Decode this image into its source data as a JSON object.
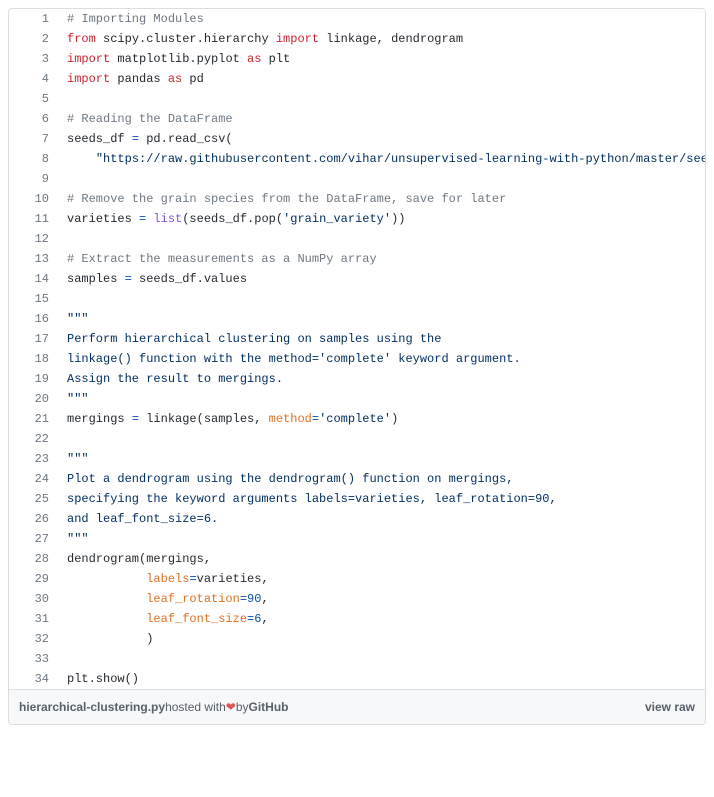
{
  "lines": [
    {
      "n": 1,
      "segs": [
        {
          "c": "pl-c",
          "t": "# Importing Modules"
        }
      ]
    },
    {
      "n": 2,
      "segs": [
        {
          "c": "pl-k",
          "t": "from"
        },
        {
          "t": " scipy.cluster.hierarchy "
        },
        {
          "c": "pl-k",
          "t": "import"
        },
        {
          "t": " linkage, dendrogram"
        }
      ]
    },
    {
      "n": 3,
      "segs": [
        {
          "c": "pl-k",
          "t": "import"
        },
        {
          "t": " matplotlib.pyplot "
        },
        {
          "c": "pl-k",
          "t": "as"
        },
        {
          "t": " plt"
        }
      ]
    },
    {
      "n": 4,
      "segs": [
        {
          "c": "pl-k",
          "t": "import"
        },
        {
          "t": " pandas "
        },
        {
          "c": "pl-k",
          "t": "as"
        },
        {
          "t": " pd"
        }
      ]
    },
    {
      "n": 5,
      "segs": []
    },
    {
      "n": 6,
      "segs": [
        {
          "c": "pl-c",
          "t": "# Reading the DataFrame"
        }
      ]
    },
    {
      "n": 7,
      "segs": [
        {
          "t": "seeds_df "
        },
        {
          "c": "pl-op",
          "t": "="
        },
        {
          "t": " pd.read_csv("
        }
      ]
    },
    {
      "n": 8,
      "segs": [
        {
          "t": "    "
        },
        {
          "c": "pl-s",
          "t": "\"https://raw.githubusercontent.com/vihar/unsupervised-learning-with-python/master/seeds"
        }
      ]
    },
    {
      "n": 9,
      "segs": []
    },
    {
      "n": 10,
      "segs": [
        {
          "c": "pl-c",
          "t": "# Remove the grain species from the DataFrame, save for later"
        }
      ]
    },
    {
      "n": 11,
      "segs": [
        {
          "t": "varieties "
        },
        {
          "c": "pl-op",
          "t": "="
        },
        {
          "t": " "
        },
        {
          "c": "pl-en",
          "t": "list"
        },
        {
          "t": "(seeds_df.pop("
        },
        {
          "c": "pl-s",
          "t": "'grain_variety'"
        },
        {
          "t": "))"
        }
      ]
    },
    {
      "n": 12,
      "segs": []
    },
    {
      "n": 13,
      "segs": [
        {
          "c": "pl-c",
          "t": "# Extract the measurements as a NumPy array"
        }
      ]
    },
    {
      "n": 14,
      "segs": [
        {
          "t": "samples "
        },
        {
          "c": "pl-op",
          "t": "="
        },
        {
          "t": " seeds_df.values"
        }
      ]
    },
    {
      "n": 15,
      "segs": []
    },
    {
      "n": 16,
      "segs": [
        {
          "c": "pl-s",
          "t": "\"\"\""
        }
      ]
    },
    {
      "n": 17,
      "segs": [
        {
          "c": "pl-s",
          "t": "Perform hierarchical clustering on samples using the"
        }
      ]
    },
    {
      "n": 18,
      "segs": [
        {
          "c": "pl-s",
          "t": "linkage() function with the method='complete' keyword argument."
        }
      ]
    },
    {
      "n": 19,
      "segs": [
        {
          "c": "pl-s",
          "t": "Assign the result to mergings."
        }
      ]
    },
    {
      "n": 20,
      "segs": [
        {
          "c": "pl-s",
          "t": "\"\"\""
        }
      ]
    },
    {
      "n": 21,
      "segs": [
        {
          "t": "mergings "
        },
        {
          "c": "pl-op",
          "t": "="
        },
        {
          "t": " linkage(samples, "
        },
        {
          "c": "pl-v",
          "t": "method"
        },
        {
          "c": "pl-op",
          "t": "="
        },
        {
          "c": "pl-s",
          "t": "'complete'"
        },
        {
          "t": ")"
        }
      ]
    },
    {
      "n": 22,
      "segs": []
    },
    {
      "n": 23,
      "segs": [
        {
          "c": "pl-s",
          "t": "\"\"\""
        }
      ]
    },
    {
      "n": 24,
      "segs": [
        {
          "c": "pl-s",
          "t": "Plot a dendrogram using the dendrogram() function on mergings,"
        }
      ]
    },
    {
      "n": 25,
      "segs": [
        {
          "c": "pl-s",
          "t": "specifying the keyword arguments labels=varieties, leaf_rotation=90,"
        }
      ]
    },
    {
      "n": 26,
      "segs": [
        {
          "c": "pl-s",
          "t": "and leaf_font_size=6."
        }
      ]
    },
    {
      "n": 27,
      "segs": [
        {
          "c": "pl-s",
          "t": "\"\"\""
        }
      ]
    },
    {
      "n": 28,
      "segs": [
        {
          "t": "dendrogram(mergings,"
        }
      ]
    },
    {
      "n": 29,
      "segs": [
        {
          "t": "           "
        },
        {
          "c": "pl-v",
          "t": "labels"
        },
        {
          "c": "pl-op",
          "t": "="
        },
        {
          "t": "varieties,"
        }
      ]
    },
    {
      "n": 30,
      "segs": [
        {
          "t": "           "
        },
        {
          "c": "pl-v",
          "t": "leaf_rotation"
        },
        {
          "c": "pl-op",
          "t": "="
        },
        {
          "c": "pl-n",
          "t": "90"
        },
        {
          "t": ","
        }
      ]
    },
    {
      "n": 31,
      "segs": [
        {
          "t": "           "
        },
        {
          "c": "pl-v",
          "t": "leaf_font_size"
        },
        {
          "c": "pl-op",
          "t": "="
        },
        {
          "c": "pl-n",
          "t": "6"
        },
        {
          "t": ","
        }
      ]
    },
    {
      "n": 32,
      "segs": [
        {
          "t": "           )"
        }
      ]
    },
    {
      "n": 33,
      "segs": []
    },
    {
      "n": 34,
      "segs": [
        {
          "t": "plt.show()"
        }
      ]
    }
  ],
  "meta": {
    "filename": "hierarchical-clustering.py",
    "hosted_prefix": " hosted with ",
    "hosted_by": " by ",
    "github": "GitHub",
    "view_raw": "view raw"
  }
}
